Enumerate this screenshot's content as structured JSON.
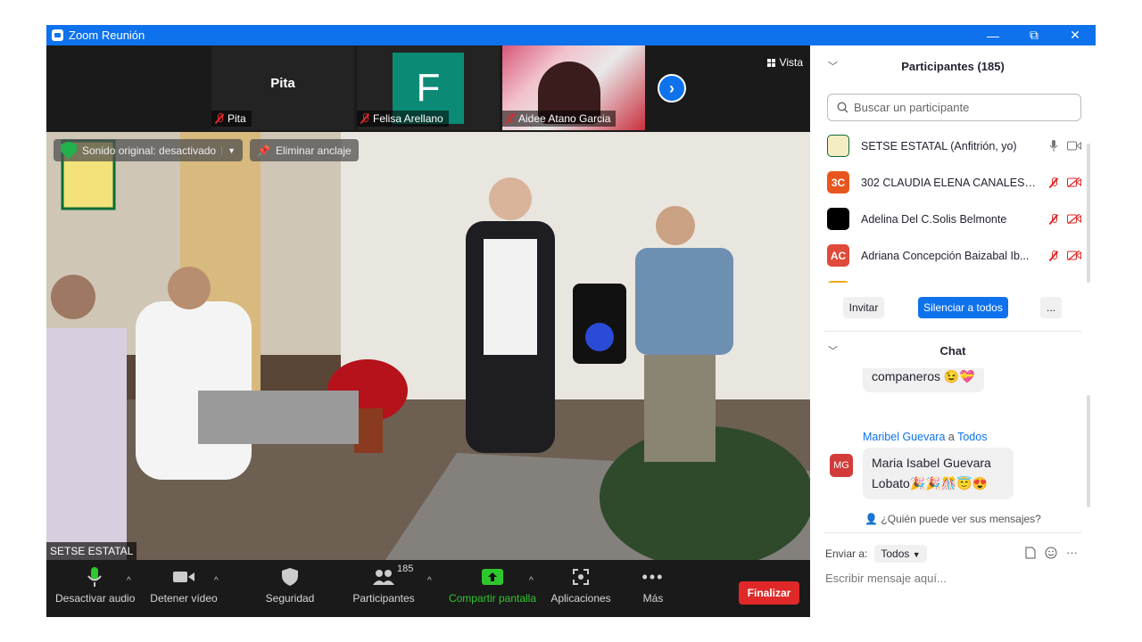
{
  "window": {
    "title": "Zoom Reunión",
    "controls": {
      "minimize": "—",
      "restore": "⧉",
      "close": "✕"
    }
  },
  "strip": {
    "tiles": [
      {
        "name": "Pita",
        "display_name": "Pita"
      },
      {
        "name": "Felisa Arellano",
        "initial": "F",
        "color": "#0b8a76"
      },
      {
        "name": "Aidee Atano Garcia"
      }
    ],
    "view_label": "Vista",
    "next_icon": "chevron-right-icon"
  },
  "main_video": {
    "original_sound": "Sonido original: desactivado",
    "unpin": "Eliminar anclaje",
    "speaker": "SETSE ESTATAL"
  },
  "controls": {
    "mute": "Desactivar audio",
    "stop_video": "Detener vídeo",
    "security": "Seguridad",
    "participants": "Participantes",
    "participants_count": "185",
    "share": "Compartir pantalla",
    "apps": "Aplicaciones",
    "more": "Más",
    "end": "Finalizar",
    "colors": {
      "share": "#2ec72e",
      "end": "#e02828"
    }
  },
  "participants_panel": {
    "title": "Participantes (185)",
    "search_placeholder": "Buscar un participante",
    "list": [
      {
        "initials": "",
        "name": "SETSE ESTATAL (Anfitrión, yo)",
        "color": "#f4ecc2"
      },
      {
        "initials": "3C",
        "name": "302 CLAUDIA ELENA CANALES ...",
        "color": "#e8561e"
      },
      {
        "initials": "",
        "name": "Adelina Del C.Solis Belmonte",
        "color": "#000000"
      },
      {
        "initials": "AC",
        "name": "Adriana Concepción Baizabal Ib...",
        "color": "#e04a3a"
      }
    ],
    "invite": "Invitar",
    "mute_all": "Silenciar a todos",
    "more": "..."
  },
  "chat": {
    "title": "Chat",
    "partial_message": "companeros 😉💝",
    "sender": "Maribel Guevara",
    "to_word": "a",
    "recipient": "Todos",
    "avatar": "MG",
    "message_line1": "Maria Isabel Guevara",
    "message_line2": "Lobato🎉🎉🎊😇😍",
    "who_can_see": "¿Quién puede ver sus mensajes?",
    "send_to_label": "Enviar a:",
    "send_to_value": "Todos",
    "input_placeholder": "Escribir mensaje aquí..."
  }
}
